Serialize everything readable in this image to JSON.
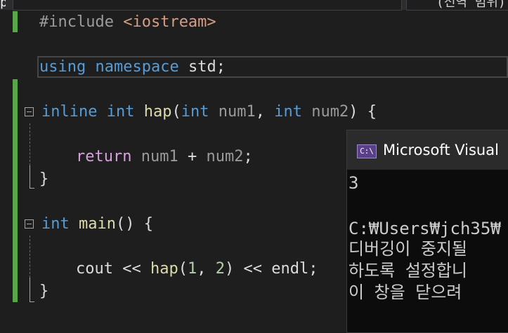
{
  "top": {
    "tab_fragment": "p",
    "search_text": "(전역 범위)"
  },
  "code": {
    "line1": {
      "directive": "#include",
      "header": "<iostream>"
    },
    "line2": {
      "kw1": "using",
      "kw2": "namespace",
      "rest": "std;"
    },
    "line3": {
      "kw_inline": "inline",
      "kw_int": "int",
      "fn_name": "hap",
      "paren_open": "(",
      "kw_int2": "int",
      "param1": "num1",
      "sep": ", ",
      "kw_int3": "int",
      "param2": "num2",
      "close": ") {"
    },
    "line4": {
      "kw_return": "return",
      "param1": "num1",
      "op": " + ",
      "param2": "num2",
      "semi": ";"
    },
    "line5": {
      "brace": "}"
    },
    "line6": {
      "kw_int": "int",
      "fn_name": "main",
      "rest": "() {"
    },
    "line7": {
      "ident": "cout",
      "op1": " << ",
      "fn_name": "hap",
      "paren_open": "(",
      "num1": "1",
      "comma": ", ",
      "num2": "2",
      "paren_close": ")",
      "op2": " << ",
      "endl": "endl",
      "semi": ";"
    },
    "line8": {
      "brace": "}"
    }
  },
  "console": {
    "icon_label": "C:\\",
    "title": "Microsoft Visual",
    "output_value": "3",
    "path_line": "C:₩Users₩jch35₩",
    "msg_line1": "디버깅이 중지될",
    "msg_line2": "하도록 설정합니",
    "msg_line3": "이 창을 닫으려"
  },
  "colors": {
    "editor_background": "#1e1e1e",
    "keyword": "#569cd6",
    "control_keyword": "#d8a0df",
    "function": "#dcdcaa",
    "parameter": "#9a9a9a",
    "number": "#b5cea8",
    "change_bar": "#57a64a",
    "console_background": "#0c0c0c"
  },
  "icons": [
    "collapse-box-icon",
    "console-app-icon"
  ]
}
